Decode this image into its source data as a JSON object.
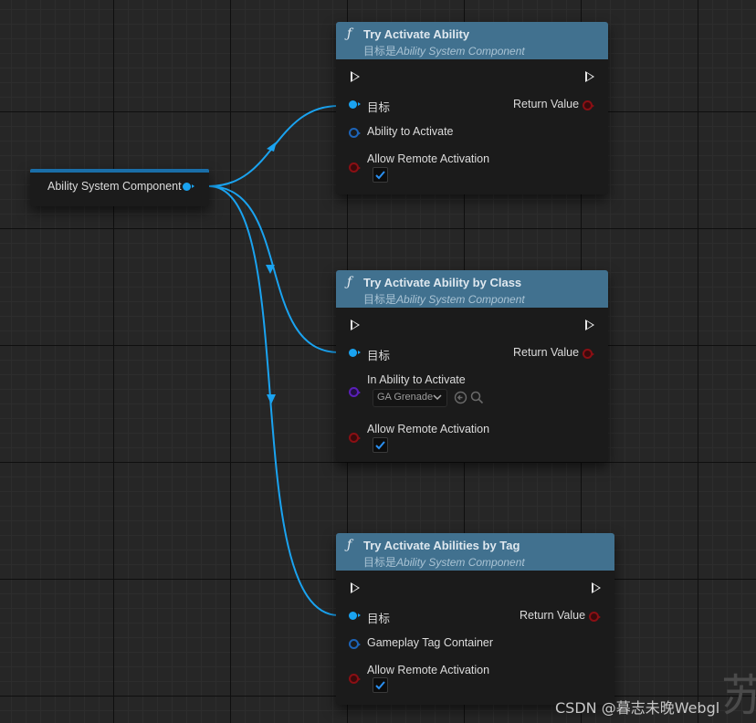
{
  "variable_node": {
    "label": "Ability System Component"
  },
  "nodes": [
    {
      "title": "Try Activate Ability",
      "subtitle_prefix": "目标是",
      "subtitle_class": "Ability System Component",
      "target_label": "目标",
      "return_label": "Return Value",
      "input_label": "Ability to Activate",
      "remote_label": "Allow Remote Activation",
      "remote_checked": true
    },
    {
      "title": "Try Activate Ability by Class",
      "subtitle_prefix": "目标是",
      "subtitle_class": "Ability System Component",
      "target_label": "目标",
      "return_label": "Return Value",
      "input_label": "In Ability to Activate",
      "input_value": "GA Grenade",
      "remote_label": "Allow Remote Activation",
      "remote_checked": true
    },
    {
      "title": "Try Activate Abilities by Tag",
      "subtitle_prefix": "目标是",
      "subtitle_class": "Ability System Component",
      "target_label": "目标",
      "return_label": "Return Value",
      "input_label": "Gameplay Tag Container",
      "remote_label": "Allow Remote Activation",
      "remote_checked": true
    }
  ],
  "watermark": "CSDN @暮志未晚Webgl",
  "colors": {
    "header": "#41718f",
    "object_pin": "#1aa3f0",
    "bool_pin": "#8a0f14",
    "class_pin": "#5a1fb8",
    "wire": "#1aa3f0"
  }
}
